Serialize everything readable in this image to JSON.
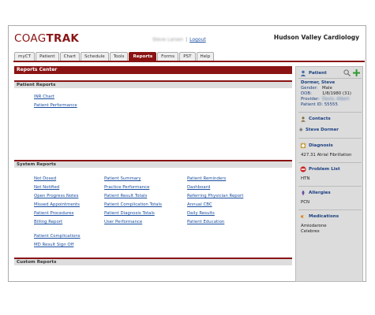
{
  "app": {
    "logo_light": "COAG",
    "logo_bold": "TRAK",
    "user_name": "Steve Larsen",
    "logout_label": "Logout",
    "organization": "Hudson Valley Cardiology"
  },
  "tabs": [
    {
      "label": "myCT"
    },
    {
      "label": "Patient"
    },
    {
      "label": "Chart"
    },
    {
      "label": "Schedule"
    },
    {
      "label": "Tools"
    },
    {
      "label": "Reports",
      "active": true
    },
    {
      "label": "Forms"
    },
    {
      "label": "PST"
    },
    {
      "label": "Help"
    }
  ],
  "main": {
    "title": "Reports Center",
    "patient_reports": {
      "heading": "Patient Reports",
      "links": [
        "INR Chart",
        "Patient Performance"
      ]
    },
    "system_reports": {
      "heading": "System Reports",
      "col1": [
        "Not Dosed",
        "Not Notified",
        "Open Progress Notes",
        "Missed Appointments",
        "Patient Procedures",
        "Billing Report"
      ],
      "col2": [
        "Patient Summary",
        "Practice Performance",
        "Patient Result Totals",
        "Patient Complication Totals",
        "Patient Diagnosis Totals",
        "User Performance"
      ],
      "col3": [
        "Patient Reminders",
        "Dashboard",
        "Referring Physician Report",
        "Annual CBC",
        "Daily Results",
        "Patient Education"
      ],
      "extra": [
        "Patient Complications",
        "MD Result Sign Off"
      ]
    },
    "custom_reports": {
      "heading": "Custom Reports"
    }
  },
  "sidebar": {
    "patient": {
      "heading": "Patient",
      "name": "Dormer, Steve",
      "gender_label": "Gender:",
      "gender": "Male",
      "dob_label": "DOB:",
      "dob": "1/8/1980 (31)",
      "provider_label": "Provider:",
      "provider": "Davis, Albert",
      "patient_id": "Patient ID: 55555"
    },
    "contacts": {
      "heading": "Contacts",
      "items": [
        "Steve Dormer"
      ]
    },
    "diagnosis": {
      "heading": "Diagnosis",
      "items": [
        "427.31 Atrial Fibrillation"
      ]
    },
    "problem_list": {
      "heading": "Problem List",
      "items": [
        "HTN"
      ]
    },
    "allergies": {
      "heading": "Allergies",
      "items": [
        "PCN"
      ]
    },
    "medications": {
      "heading": "Medications",
      "items": [
        "Amiodarone",
        "Celebrex"
      ]
    }
  }
}
